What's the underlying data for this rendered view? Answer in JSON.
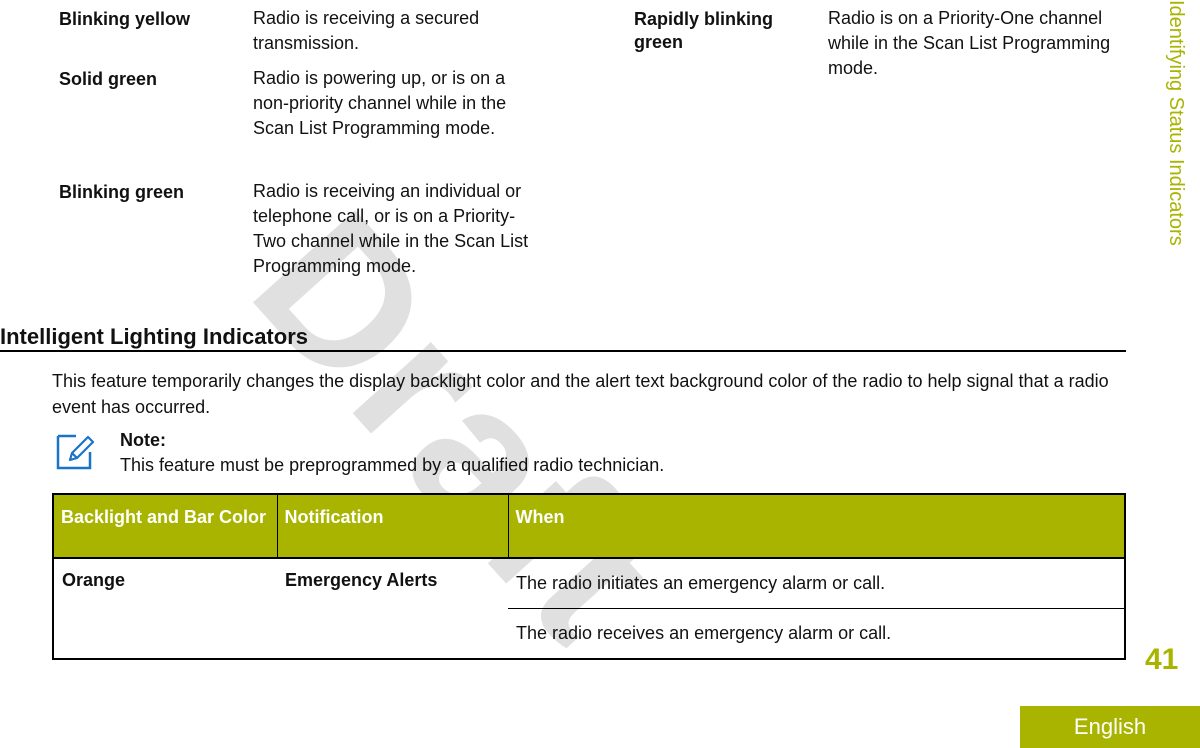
{
  "side_title": "Identifying Status Indicators",
  "watermark": "Draft",
  "led_table": {
    "left": [
      {
        "label": "Blinking yellow",
        "description": "Radio is receiving a secured transmission."
      },
      {
        "label": "Solid green",
        "description": "Radio is powering up, or is on a non-priority channel while in the Scan List Programming mode."
      },
      {
        "label": "Blinking green",
        "description": "Radio is receiving an individual or telephone call, or is on a Priority-Two channel while in the Scan List Programming mode."
      }
    ],
    "right": [
      {
        "label": "Rapidly blinking green",
        "description": "Radio is on a Priority-One channel while in the Scan List Programming mode."
      }
    ]
  },
  "section": {
    "title": "Intelligent Lighting Indicators",
    "paragraph": "This feature temporarily changes the display backlight color and the alert text background color of the radio to help signal that a radio event has occurred.",
    "note": {
      "icon": "note-pencil-icon",
      "heading": "Note:",
      "body": "This feature must be preprogrammed by a qualified radio technician."
    }
  },
  "lighting_table": {
    "headers": [
      "Backlight and Bar Color",
      "Notification",
      "When"
    ],
    "rows": [
      {
        "color": "Orange",
        "notification": "Emergency Alerts",
        "when": [
          "The radio initiates an emergency alarm or call.",
          "The radio receives an emergency alarm or call."
        ]
      }
    ]
  },
  "footer": {
    "page_number": "41",
    "language": "English"
  },
  "colors": {
    "accent": "#a8b400",
    "note_icon": "#1a73c8"
  }
}
